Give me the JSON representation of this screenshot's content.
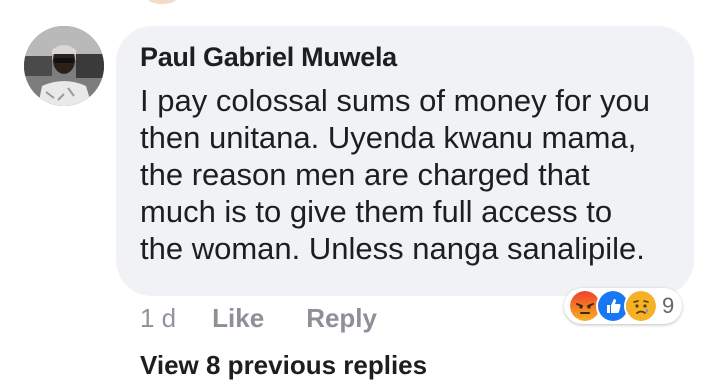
{
  "comment": {
    "author": "Paul Gabriel Muwela",
    "text": "I pay colossal sums of money for you\nthen unitana. Uyenda kwanu mama,\nthe reason men are charged that\nmuch is to give them full access to\nthe woman. Unless nanga sanalipile.",
    "time": "1 d",
    "like_label": "Like",
    "reply_label": "Reply",
    "reactions": {
      "icons": [
        "angry-icon",
        "like-icon",
        "sad-icon"
      ],
      "count": "9"
    }
  },
  "view_previous_replies": "View 8 previous replies",
  "colors": {
    "bubble": "#f0f2f5",
    "like_blue": "#1877f2",
    "angry": "#e9710f",
    "sad": "#f7b125",
    "meta_text": "#90949c"
  }
}
